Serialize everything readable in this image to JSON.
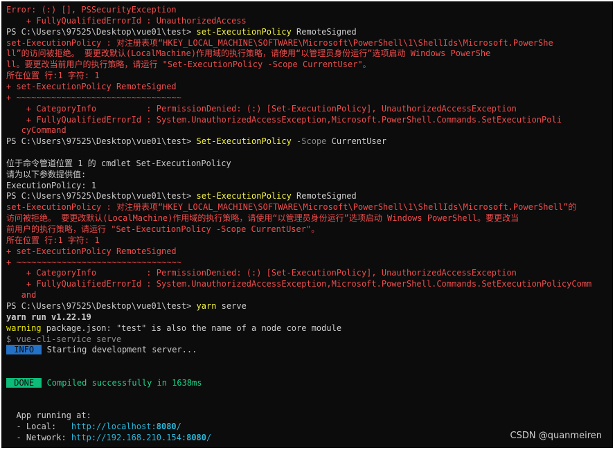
{
  "lines": [
    {
      "s": [
        [
          "e",
          "Error: (:) [], PSSecurityException"
        ]
      ]
    },
    {
      "s": [
        [
          "e",
          "    + FullyQualifiedErrorId : UnauthorizedAccess"
        ]
      ]
    },
    {
      "s": [
        [
          "w",
          "PS C:\\Users\\97525\\Desktop\\vue01\\test> "
        ],
        [
          "y",
          "set-ExecutionPolicy"
        ],
        [
          "w",
          " RemoteSigned"
        ]
      ]
    },
    {
      "s": [
        [
          "e",
          "set-ExecutionPolicy : 对注册表项“HKEY_LOCAL_MACHINE\\SOFTWARE\\Microsoft\\PowerShell\\1\\ShellIds\\Microsoft.PowerShe"
        ]
      ]
    },
    {
      "s": [
        [
          "e",
          "ll”的访问被拒绝。 要更改默认(LocalMachine)作用域的执行策略，请使用“以管理员身份运行”选项启动 Windows PowerShe"
        ]
      ]
    },
    {
      "s": [
        [
          "e",
          "ll。要更改当前用户的执行策略，请运行 \"Set-ExecutionPolicy -Scope CurrentUser\"。"
        ]
      ]
    },
    {
      "s": [
        [
          "e",
          "所在位置 行:1 字符: 1"
        ]
      ]
    },
    {
      "s": [
        [
          "e",
          "+ set-ExecutionPolicy RemoteSigned"
        ]
      ]
    },
    {
      "s": [
        [
          "e",
          "+ ~~~~~~~~~~~~~~~~~~~~~~~~~~~~~~~~~"
        ]
      ]
    },
    {
      "s": [
        [
          "e",
          "    + CategoryInfo          : PermissionDenied: (:) [Set-ExecutionPolicy], UnauthorizedAccessException"
        ]
      ]
    },
    {
      "s": [
        [
          "e",
          "    + FullyQualifiedErrorId : System.UnauthorizedAccessException,Microsoft.PowerShell.Commands.SetExecutionPoli"
        ]
      ]
    },
    {
      "s": [
        [
          "e",
          "   cyCommand"
        ]
      ]
    },
    {
      "s": [
        [
          "w",
          "PS C:\\Users\\97525\\Desktop\\vue01\\test> "
        ],
        [
          "y",
          "Set-ExecutionPolicy"
        ],
        [
          "g",
          " -Scope"
        ],
        [
          "w",
          " CurrentUser"
        ]
      ]
    },
    {
      "s": []
    },
    {
      "s": [
        [
          "w",
          "位于命令管道位置 1 的 cmdlet Set-ExecutionPolicy"
        ]
      ]
    },
    {
      "s": [
        [
          "w",
          "请为以下参数提供值:"
        ]
      ]
    },
    {
      "s": [
        [
          "w",
          "ExecutionPolicy: 1"
        ]
      ]
    },
    {
      "s": [
        [
          "w",
          "PS C:\\Users\\97525\\Desktop\\vue01\\test> "
        ],
        [
          "y",
          "set-ExecutionPolicy"
        ],
        [
          "w",
          " RemoteSigned"
        ]
      ]
    },
    {
      "s": [
        [
          "e",
          "set-ExecutionPolicy : 对注册表项“HKEY_LOCAL_MACHINE\\SOFTWARE\\Microsoft\\PowerShell\\1\\ShellIds\\Microsoft.PowerShell”的"
        ]
      ]
    },
    {
      "s": [
        [
          "e",
          "访问被拒绝。 要更改默认(LocalMachine)作用域的执行策略，请使用“以管理员身份运行”选项启动 Windows PowerShell。要更改当"
        ]
      ]
    },
    {
      "s": [
        [
          "e",
          "前用户的执行策略，请运行 \"Set-ExecutionPolicy -Scope CurrentUser\"。"
        ]
      ]
    },
    {
      "s": [
        [
          "e",
          "所在位置 行:1 字符: 1"
        ]
      ]
    },
    {
      "s": [
        [
          "e",
          "+ set-ExecutionPolicy RemoteSigned"
        ]
      ]
    },
    {
      "s": [
        [
          "e",
          "+ ~~~~~~~~~~~~~~~~~~~~~~~~~~~~~~~~~"
        ]
      ]
    },
    {
      "s": [
        [
          "e",
          "    + CategoryInfo          : PermissionDenied: (:) [Set-ExecutionPolicy], UnauthorizedAccessException"
        ]
      ]
    },
    {
      "s": [
        [
          "e",
          "    + FullyQualifiedErrorId : System.UnauthorizedAccessException,Microsoft.PowerShell.Commands.SetExecutionPolicyComm"
        ]
      ]
    },
    {
      "s": [
        [
          "e",
          "   and"
        ]
      ]
    },
    {
      "s": [
        [
          "w",
          "PS C:\\Users\\97525\\Desktop\\vue01\\test> "
        ],
        [
          "y",
          "yarn"
        ],
        [
          "w",
          " serve"
        ]
      ]
    },
    {
      "s": [
        [
          "w bold",
          "yarn run v1.22.19"
        ]
      ]
    },
    {
      "s": [
        [
          "ylw",
          "warning"
        ],
        [
          "w",
          " package.json: \"test\" is also the name of a node core module"
        ]
      ]
    },
    {
      "s": [
        [
          "g",
          "$ vue-cli-service serve"
        ]
      ]
    },
    {
      "s": [
        [
          "badge-info",
          " INFO "
        ],
        [
          "w",
          " Starting development server..."
        ]
      ]
    },
    {
      "s": []
    },
    {
      "s": []
    },
    {
      "s": [
        [
          "badge-done",
          " DONE "
        ],
        [
          "grn",
          " Compiled successfully in 1638ms"
        ]
      ]
    },
    {
      "s": []
    },
    {
      "s": []
    },
    {
      "s": [
        [
          "w",
          "  App running at:"
        ]
      ]
    },
    {
      "s": [
        [
          "w",
          "  - Local:   "
        ],
        [
          "cyan",
          "http://localhost:"
        ],
        [
          "cyan bold",
          "8080"
        ],
        [
          "cyan",
          "/"
        ]
      ]
    },
    {
      "s": [
        [
          "w",
          "  - Network: "
        ],
        [
          "cyan",
          "http://192.168.210.154:"
        ],
        [
          "cyan bold",
          "8080"
        ],
        [
          "cyan",
          "/"
        ]
      ]
    }
  ],
  "watermark": "CSDN @quanmeiren",
  "colors": {
    "background": "#0c0c0c",
    "error_red": "#f14c4c",
    "command_yellow": "#f5f543",
    "info_badge": "#2472c8",
    "done_badge": "#0dbc79",
    "success_green": "#23d18b",
    "url_cyan": "#29b8db"
  }
}
